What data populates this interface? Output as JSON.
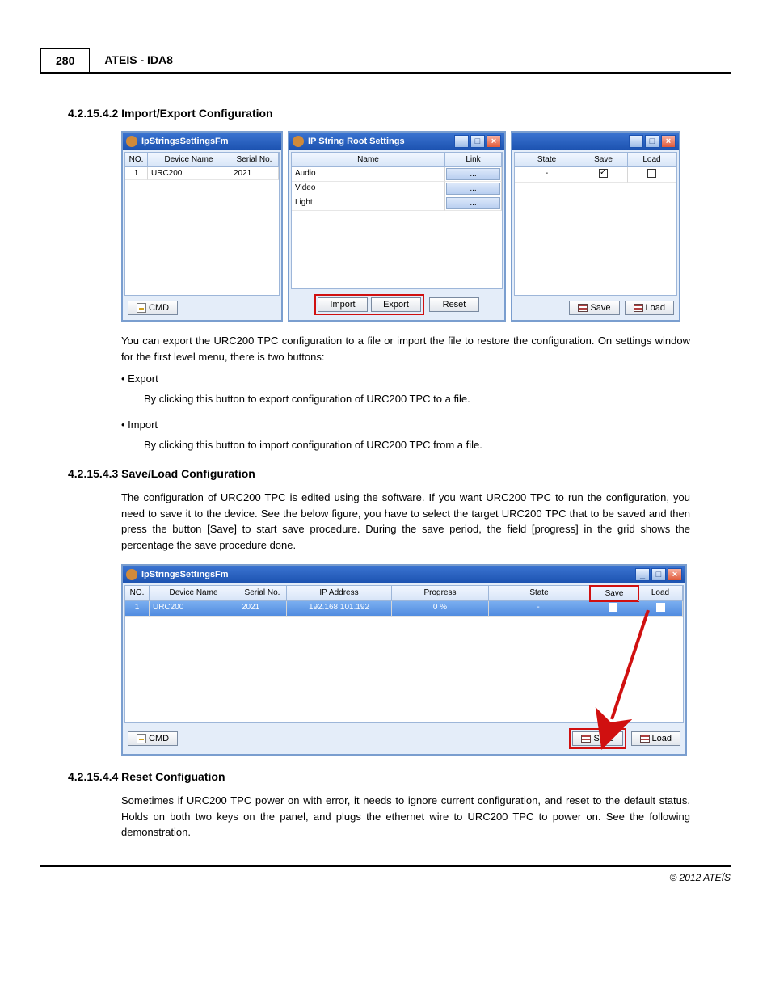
{
  "page": {
    "num": "280",
    "header": "ATEIS - IDA8",
    "footer": "© 2012 ATEÏS"
  },
  "s1": {
    "heading": "4.2.15.4.2  Import/Export Configuration",
    "para1": "You can export the URC200 TPC configuration to a file or import the file to restore the configuration. On settings window for the first level menu, there is two buttons:",
    "bullet1": "Export",
    "bullet1_desc": "By clicking this button to export configuration of URC200 TPC to a file.",
    "bullet2": "Import",
    "bullet2_desc": "By clicking this button to import configuration of URC200 TPC from a file."
  },
  "s2": {
    "heading": "4.2.15.4.3  Save/Load Configuration",
    "para": "The configuration of URC200 TPC is edited using the software. If you want URC200 TPC to run the configuration, you need to save it to the device. See the below figure, you have to select the target URC200 TPC that to be saved and then press the button [Save] to start save procedure. During the save period, the field [progress] in the grid shows the percentage the save procedure done."
  },
  "s3": {
    "heading": "4.2.15.4.4  Reset Configuation",
    "para": "Sometimes if URC200 TPC power on with error, it needs to ignore current configuration, and reset to the default status. Holds on both two keys on the panel, and plugs the ethernet wire to URC200 TPC to power on. See the following demonstration."
  },
  "winA": {
    "title": "IpStringsSettingsFm",
    "cols": {
      "no": "NO.",
      "device": "Device Name",
      "serial": "Serial No."
    },
    "row": {
      "no": "1",
      "device": "URC200",
      "serial": "2021"
    },
    "cmd": "CMD"
  },
  "winB": {
    "title": "IP String Root Settings",
    "cols": {
      "name": "Name",
      "link": "Link"
    },
    "rows": [
      {
        "name": "Audio",
        "link": "..."
      },
      {
        "name": "Video",
        "link": "..."
      },
      {
        "name": "Light",
        "link": "..."
      }
    ],
    "import": "Import",
    "export": "Export",
    "reset": "Reset"
  },
  "winC": {
    "cols": {
      "state": "State",
      "save": "Save",
      "load": "Load"
    },
    "row": {
      "state": "-"
    },
    "save": "Save",
    "load": "Load"
  },
  "winD": {
    "title": "IpStringsSettingsFm",
    "cols": {
      "no": "NO.",
      "device": "Device Name",
      "serial": "Serial No.",
      "ip": "IP Address",
      "progress": "Progress",
      "state": "State",
      "save": "Save",
      "load": "Load"
    },
    "row": {
      "no": "1",
      "device": "URC200",
      "serial": "2021",
      "ip": "192.168.101.192",
      "progress": "0 %",
      "state": "-"
    },
    "cmd": "CMD",
    "save": "Save",
    "load": "Load"
  }
}
